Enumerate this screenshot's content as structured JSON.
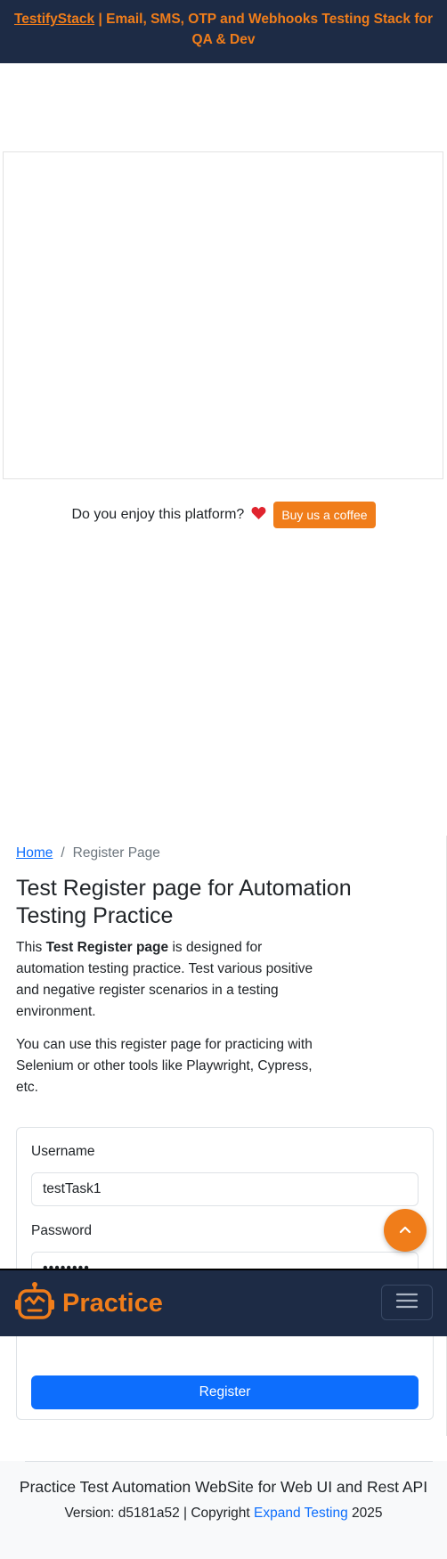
{
  "banner": {
    "link_text": "TestifyStack",
    "text": " | Email, SMS, OTP and Webhooks Testing Stack for QA & Dev"
  },
  "coffee": {
    "question": "Do you enjoy this platform?",
    "heart_icon": "heart-icon",
    "button_label": "Buy us a coffee"
  },
  "breadcrumb": {
    "home": "Home",
    "separator": "/",
    "current": "Register Page"
  },
  "page": {
    "title": "Test Register page for Automation Testing Practice",
    "intro_before": "This ",
    "intro_bold": "Test Register page",
    "intro_after": " is designed for automation testing practice. Test various positive and negative register scenarios in a testing environment.",
    "tools_text": "You can use this register page for practicing with Selenium or other tools like Playwright, Cypress, etc."
  },
  "form": {
    "username_label": "Username",
    "username_value": "testTask1",
    "password_label": "Password",
    "password_value": "••••••••",
    "confirm_value": "••••••••",
    "register_label": "Register"
  },
  "navbar": {
    "brand": "Practice",
    "logo_icon": "robot-icon",
    "menu_icon": "hamburger-icon"
  },
  "footer": {
    "title": "Practice Test Automation WebSite for Web UI and Rest API",
    "version_prefix": "Version: d5181a52 | Copyright ",
    "company_link": "Expand Testing",
    "year": " 2025"
  },
  "colors": {
    "brand_orange": "#f07d1a",
    "navy": "#1d2b45",
    "primary_blue": "#0d6efd"
  }
}
